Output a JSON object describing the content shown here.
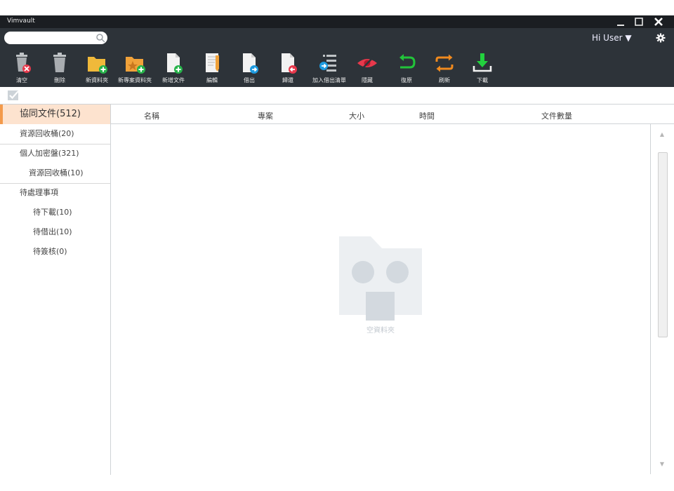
{
  "app": {
    "title": "Vimvault"
  },
  "window_controls": {
    "minimize": "minimize-icon",
    "maximize": "maximize-icon",
    "close": "close-icon"
  },
  "search": {
    "placeholder": "",
    "value": ""
  },
  "user": {
    "label": "Hi User ▼"
  },
  "toolbar": [
    {
      "id": "clear",
      "label": "清空",
      "icon": "trash-clear-icon"
    },
    {
      "id": "delete",
      "label": "刪除",
      "icon": "trash-icon"
    },
    {
      "id": "new-folder",
      "label": "新資料夾",
      "icon": "folder-add-icon"
    },
    {
      "id": "new-project-folder",
      "label": "新專案資料夾",
      "icon": "project-folder-add-icon"
    },
    {
      "id": "new-document",
      "label": "新增文件",
      "icon": "document-add-icon"
    },
    {
      "id": "edit",
      "label": "編輯",
      "icon": "edit-document-icon"
    },
    {
      "id": "borrow",
      "label": "借出",
      "icon": "borrow-icon"
    },
    {
      "id": "return",
      "label": "歸還",
      "icon": "return-icon"
    },
    {
      "id": "add-borrow-list",
      "label": "加入借出清單",
      "icon": "borrow-list-icon"
    },
    {
      "id": "hide",
      "label": "隱藏",
      "icon": "eye-hidden-icon"
    },
    {
      "id": "restore",
      "label": "復原",
      "icon": "undo-icon"
    },
    {
      "id": "refresh",
      "label": "刷新",
      "icon": "refresh-icon"
    },
    {
      "id": "download",
      "label": "下載",
      "icon": "download-icon"
    }
  ],
  "sidebar": {
    "items": [
      {
        "label": "協同文件(512)",
        "active": true
      },
      {
        "label": "資源回收桶(20)"
      },
      {
        "label": "個人加密盤(321)"
      },
      {
        "label": "資源回收桶(10)"
      },
      {
        "label": "待處理事項"
      },
      {
        "label": "待下載(10)"
      },
      {
        "label": "待借出(10)"
      },
      {
        "label": "待簽核(0)"
      }
    ]
  },
  "table": {
    "columns": [
      "名稱",
      "專案",
      "大小",
      "時間",
      "文件數量"
    ]
  },
  "empty_state": {
    "label": "空資料夾"
  },
  "colors": {
    "titlebar": "#1b1e22",
    "header": "#2d3339",
    "accent": "#f39a4b",
    "active_bg": "#fde3cf"
  }
}
